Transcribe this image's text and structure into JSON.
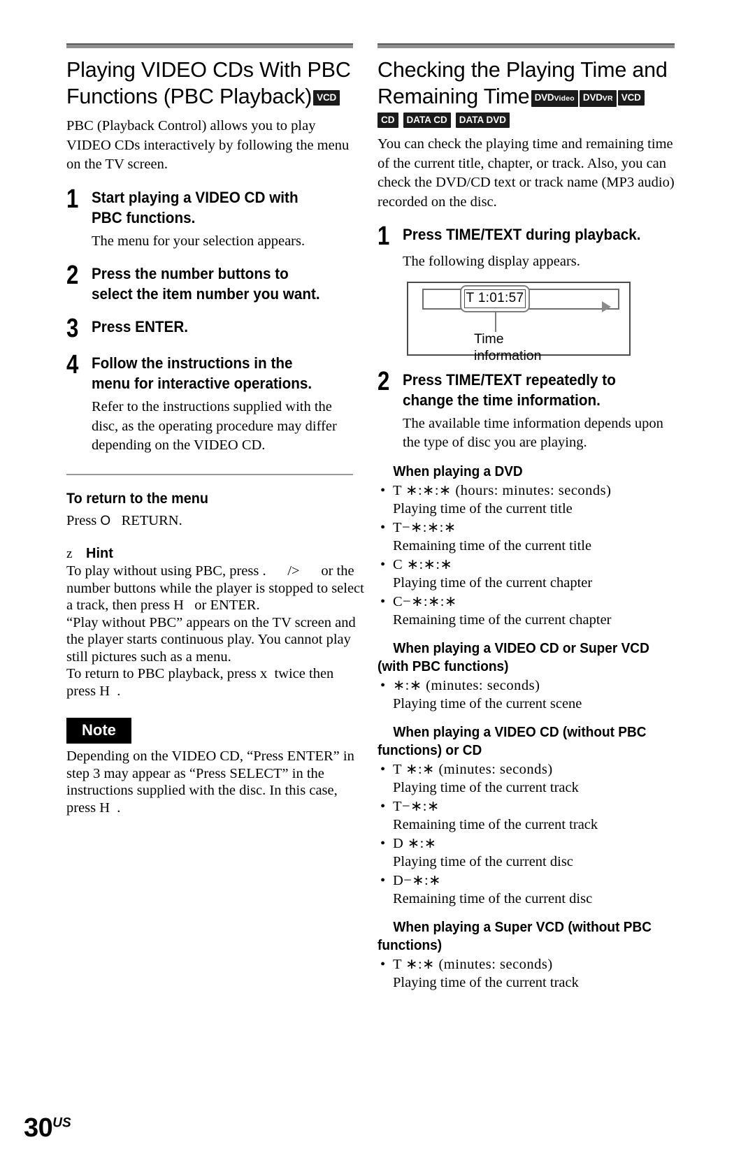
{
  "page": {
    "number": "30",
    "region": "US"
  },
  "left_column": {
    "heading_line1": "Playing VIDEO CDs With PBC",
    "heading_line2": "Functions (PBC Playback)",
    "heading_badge": "VCD",
    "intro": "PBC (Playback Control) allows you to play VIDEO CDs interactively by following the menu on the TV screen.",
    "steps": [
      {
        "number": "1",
        "text": "Start playing a VIDEO CD with PBC functions.",
        "body": "The menu for your selection appears."
      },
      {
        "number": "2",
        "text": "Press the number buttons to select the item number you want.",
        "body": ""
      },
      {
        "number": "3",
        "text": "Press ENTER.",
        "body": ""
      },
      {
        "number": "4",
        "text": "Follow the instructions in the menu for interactive operations.",
        "body": "Refer to the instructions supplied with the disc, as the operating procedure may differ depending on the VIDEO CD."
      }
    ],
    "return_section": {
      "heading": "To return to the menu",
      "text_before_key": "Press ",
      "key_glyph": "O",
      "text_after_key": "RETURN."
    },
    "hint": {
      "glyph": "z",
      "label": "Hint",
      "lines": [
        "To play without using PBC, press .      />      or the",
        "number buttons while the player is stopped to select",
        "a track, then press H   or ENTER.",
        "“Play without PBC” appears on the TV screen and",
        "the player starts continuous play. You cannot play",
        "still pictures such as a menu.",
        "To return to PBC playback, press x  twice then",
        "press H  ."
      ]
    },
    "note": {
      "label": "Note",
      "lines": [
        "Depending on the VIDEO CD, “Press ENTER” in",
        "step 3 may appear as “Press SELECT” in the",
        "instructions supplied with the disc. In this case,",
        "press H  ."
      ]
    }
  },
  "right_column": {
    "heading_line1": "Checking the Playing Time and",
    "heading_line2": "Remaining Time",
    "badges_row1": [
      {
        "main": "DVD",
        "sub": "Video"
      },
      {
        "main": "DVD",
        "sub": "VR"
      },
      {
        "main": "VCD",
        "sub": ""
      }
    ],
    "badges_row2": [
      {
        "main": "CD",
        "sub": ""
      },
      {
        "main": "DATA CD",
        "sub": ""
      },
      {
        "main": "DATA DVD",
        "sub": ""
      }
    ],
    "intro": "You can check the playing time and remaining time of the current title, chapter, or track. Also, you can check the DVD/CD text or track name (MP3 audio) recorded on the disc.",
    "steps": [
      {
        "number": "1",
        "text": "Press TIME/TEXT during playback.",
        "body": "The following display appears."
      },
      {
        "number": "2",
        "text": "Press TIME/TEXT repeatedly to change the time information.",
        "body": "The available time information depends upon the type of disc you are playing."
      }
    ],
    "figure": {
      "display_value": "T   1:01:57",
      "caption_line1": "Time",
      "caption_line2": "information",
      "play_icon": "play-triangle-icon"
    },
    "sections": [
      {
        "heading": "When playing a DVD",
        "items": [
          {
            "code": "T  ∗:∗:∗ (hours: minutes: seconds)",
            "desc": "Playing time of the current title"
          },
          {
            "code": "T−∗:∗:∗",
            "desc": "Remaining time of the current title"
          },
          {
            "code": "C  ∗:∗:∗",
            "desc": "Playing time of the current chapter"
          },
          {
            "code": "C−∗:∗:∗",
            "desc": "Remaining time of the current chapter"
          }
        ]
      },
      {
        "heading": "When playing a VIDEO CD or Super VCD (with PBC functions)",
        "items": [
          {
            "code": "∗:∗ (minutes: seconds)",
            "desc": "Playing time of the current scene"
          }
        ]
      },
      {
        "heading": "When playing a VIDEO CD (without PBC functions) or CD",
        "items": [
          {
            "code": "T  ∗:∗ (minutes: seconds)",
            "desc": "Playing time of the current track"
          },
          {
            "code": "T−∗:∗",
            "desc": "Remaining time of the current track"
          },
          {
            "code": "D  ∗:∗",
            "desc": "Playing time of the current disc"
          },
          {
            "code": "D−∗:∗",
            "desc": "Remaining time of the current disc"
          }
        ]
      },
      {
        "heading": "When playing a Super VCD (without PBC functions)",
        "items": [
          {
            "code": "T  ∗:∗ (minutes: seconds)",
            "desc": "Playing time of the current track"
          }
        ]
      }
    ]
  }
}
